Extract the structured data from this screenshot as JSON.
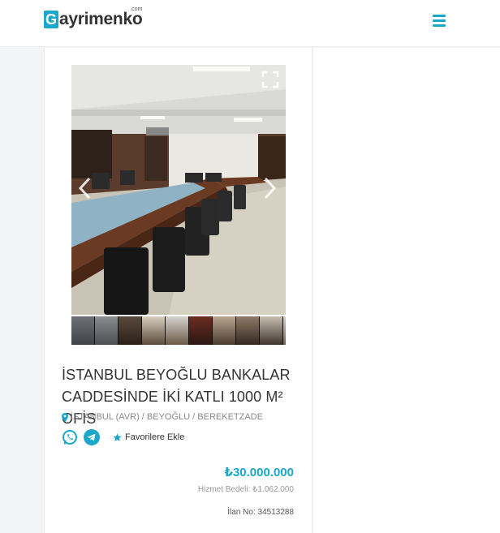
{
  "brand": {
    "logo_initial": "G",
    "logo_text": "ayrimenko",
    "logo_suffix": ".com",
    "accent": "#1ba7c9"
  },
  "header": {
    "menu_icon": "hamburger-menu-icon"
  },
  "gallery": {
    "thumbnail_count": 10
  },
  "listing": {
    "title": "İSTANBUL BEYOĞLU BANKALAR CADDESİNDE İKİ KATLI 1000 M² OFİS",
    "location": "İSTANBUL (AVR) / BEYOĞLU / BEREKETZADE",
    "favorite_label": "Favorilere Ekle",
    "price": "₺30.000.000",
    "service_fee": "Hizmet Bedeli: ₺1.062.000",
    "listing_no": "İlan No: 34513288"
  }
}
